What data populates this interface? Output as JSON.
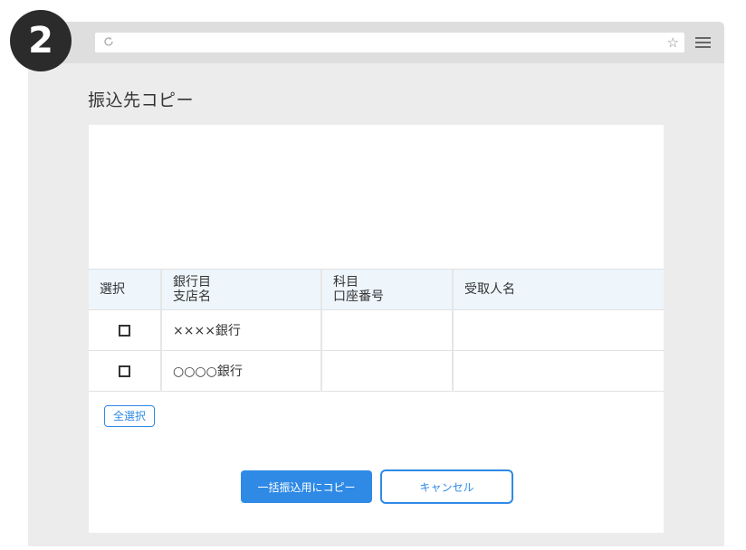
{
  "step_badge": "2",
  "browser": {
    "reload_icon": "reload-icon",
    "star_icon": "star-icon",
    "star_glyph": "☆",
    "menu_icon": "hamburger-menu-icon"
  },
  "page": {
    "title": "振込先コピー"
  },
  "table": {
    "headers": {
      "select": "選択",
      "bank_line1": "銀行目",
      "bank_line2": "支店名",
      "account_line1": "科目",
      "account_line2": "口座番号",
      "recipient": "受取人名"
    },
    "rows": [
      {
        "checked": false,
        "bank": "××××銀行",
        "account": "",
        "recipient": ""
      },
      {
        "checked": false,
        "bank": "○○○○銀行",
        "account": "",
        "recipient": ""
      }
    ]
  },
  "buttons": {
    "select_all": "全選択",
    "copy_bulk": "一括振込用にコピー",
    "cancel": "キャンセル"
  },
  "colors": {
    "accent": "#2f8ae6",
    "header_bg": "#eef6fc",
    "badge_bg": "#2b2b2b"
  }
}
